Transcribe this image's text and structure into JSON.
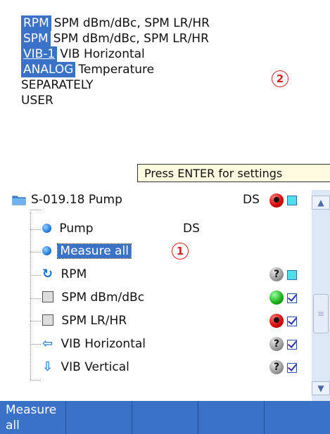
{
  "measurement_list": {
    "rows": [
      {
        "tag": "RPM",
        "text": "SPM dBm/dBc, SPM LR/HR"
      },
      {
        "tag": "SPM",
        "text": "SPM dBm/dBc, SPM LR/HR"
      },
      {
        "tag": "VIB-1",
        "text": "VIB Horizontal"
      },
      {
        "tag": "ANALOG",
        "text": "Temperature"
      },
      {
        "tag": "",
        "text": "SEPARATELY"
      },
      {
        "tag": "",
        "text": "USER"
      }
    ]
  },
  "callouts": {
    "one": "1",
    "two": "2"
  },
  "tooltip": "Press ENTER for settings",
  "tree": {
    "folder": {
      "label": "S-019.18 Pump",
      "suffix": "DS",
      "status": "red-stop",
      "check": "cyan"
    },
    "items": [
      {
        "label": "Pump",
        "suffix": "DS",
        "icon": "blue-ball-icon"
      },
      {
        "label": "Measure all",
        "selected": true,
        "icon": "blue-ball-icon"
      },
      {
        "label": "RPM",
        "icon": "refresh-icon",
        "status": "gray-unknown",
        "check": "cyan"
      },
      {
        "label": "SPM dBm/dBc",
        "icon": "spm-sensor-icon",
        "status": "green-ok",
        "check": "ticked"
      },
      {
        "label": "SPM LR/HR",
        "icon": "spm-sensor-icon",
        "status": "red-stop",
        "check": "ticked"
      },
      {
        "label": "VIB Horizontal",
        "icon": "arrow-left-icon",
        "status": "gray-unknown",
        "check": "ticked"
      },
      {
        "label": "VIB Vertical",
        "icon": "arrow-down-icon",
        "status": "gray-unknown",
        "check": "ticked"
      }
    ]
  },
  "status_glyph": "?",
  "softkeys": [
    {
      "line1": "Measure",
      "line2": "all"
    },
    {
      "line1": "",
      "line2": ""
    },
    {
      "line1": "",
      "line2": ""
    },
    {
      "line1": "",
      "line2": ""
    },
    {
      "line1": "",
      "line2": ""
    }
  ],
  "colors": {
    "highlight": "#3a72c8",
    "callout": "#d2231e",
    "tooltip_bg": "#fffbe0"
  }
}
